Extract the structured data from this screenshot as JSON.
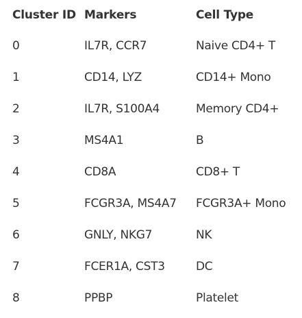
{
  "table": {
    "headers": [
      "Cluster ID",
      "Markers",
      "Cell Type"
    ],
    "rows": [
      [
        "0",
        "IL7R, CCR7",
        "Naive CD4+ T"
      ],
      [
        "1",
        "CD14, LYZ",
        "CD14+ Mono"
      ],
      [
        "2",
        "IL7R, S100A4",
        "Memory CD4+"
      ],
      [
        "3",
        "MS4A1",
        "B"
      ],
      [
        "4",
        "CD8A",
        "CD8+ T"
      ],
      [
        "5",
        "FCGR3A, MS4A7",
        "FCGR3A+ Mono"
      ],
      [
        "6",
        "GNLY, NKG7",
        "NK"
      ],
      [
        "7",
        "FCER1A, CST3",
        "DC"
      ],
      [
        "8",
        "PPBP",
        "Platelet"
      ]
    ]
  }
}
